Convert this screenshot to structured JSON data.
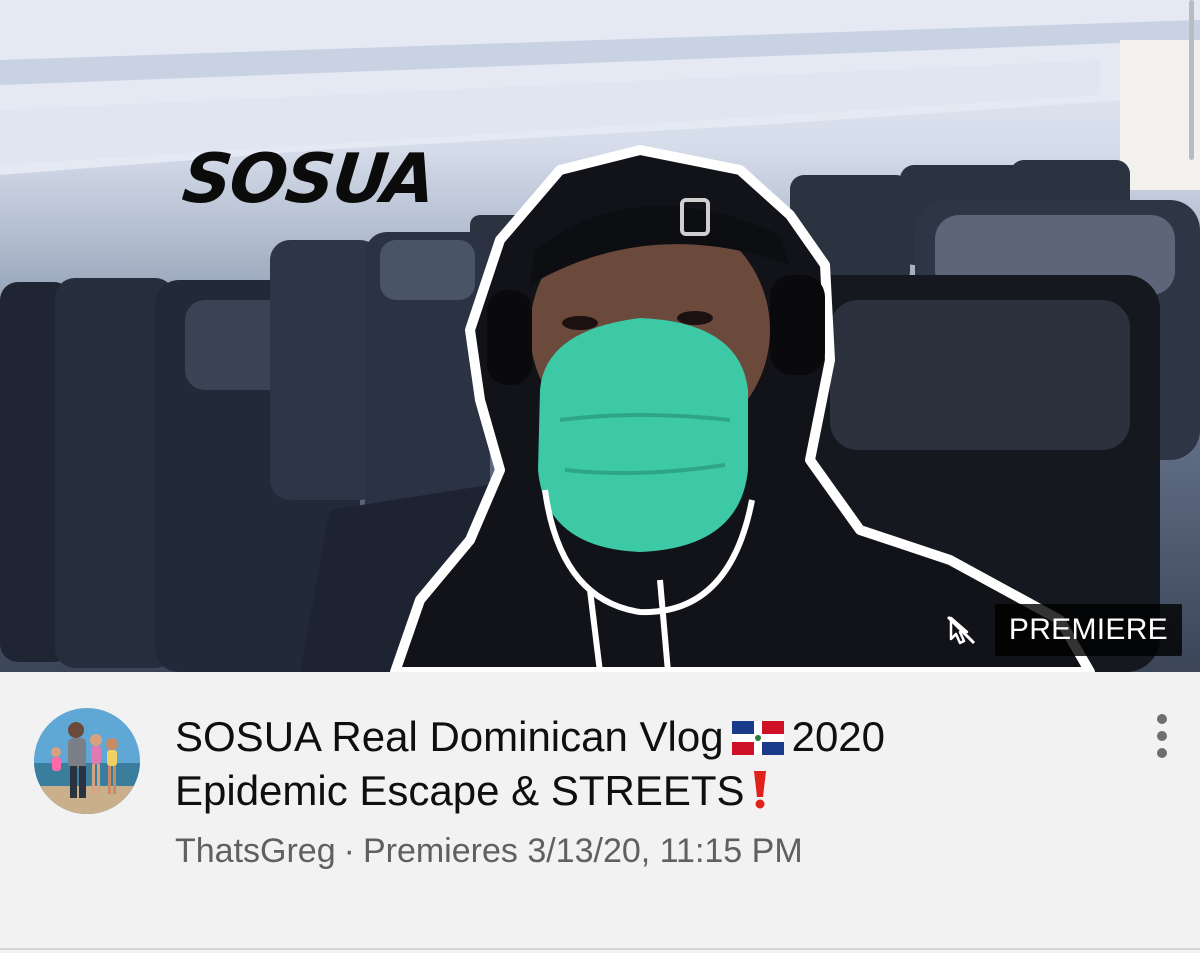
{
  "thumbnail": {
    "overlay_text": "SOSUA",
    "badge": "PREMIERE",
    "badge_icon": "cursor-off-icon"
  },
  "video": {
    "title_part1": "SOSUA Real Dominican Vlog",
    "title_part2": "2020",
    "title_part3": "Epidemic Escape & STREETS",
    "flag_icon": "dominican-republic-flag",
    "emoji_icon": "red-exclamation-icon",
    "channel": "ThatsGreg",
    "separator": "·",
    "status": "Premieres 3/13/20, 11:15 PM"
  },
  "menu": {
    "icon": "more-vertical-icon"
  },
  "colors": {
    "title": "#0f0f0f",
    "meta": "#606060",
    "mask": "#3dc9a6",
    "badge_bg": "#000000"
  }
}
